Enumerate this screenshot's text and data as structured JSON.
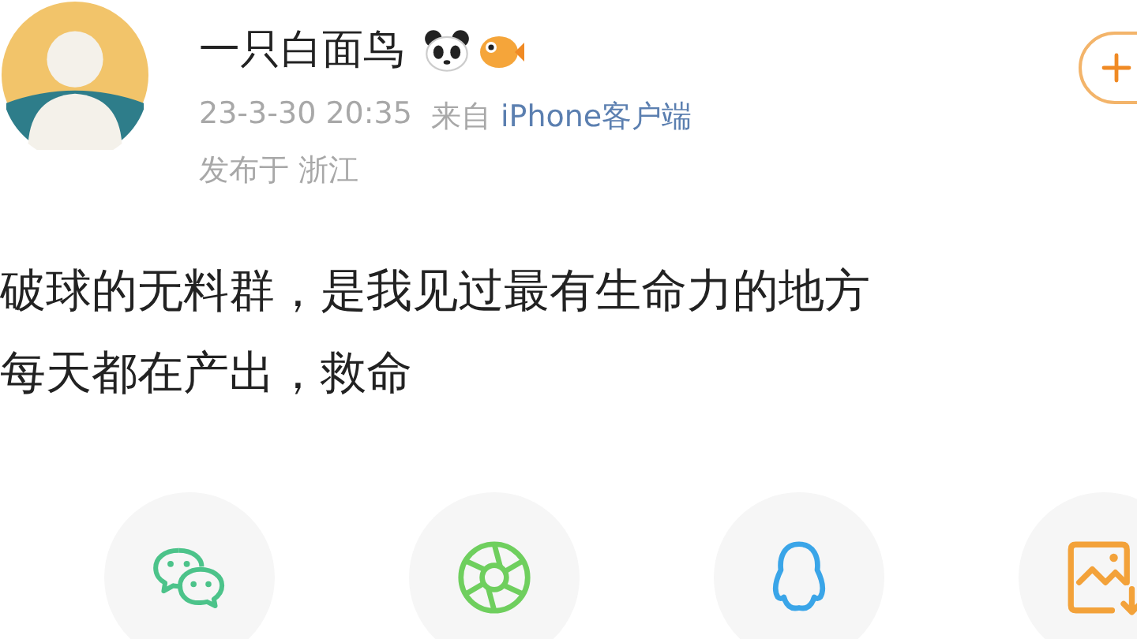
{
  "post": {
    "author": "一只白面鸟",
    "time": "23-3-30 20:35",
    "source_prefix": "来自",
    "source": "iPhone客户端",
    "location": "发布于 浙江",
    "body_lines": [
      "破球的无料群，是我见过最有生命力的地方",
      "每天都在产出，救命"
    ]
  },
  "share_buttons": [
    {
      "kind": "chat"
    },
    {
      "kind": "shutter"
    },
    {
      "kind": "penguin"
    },
    {
      "kind": "image-save"
    }
  ]
}
